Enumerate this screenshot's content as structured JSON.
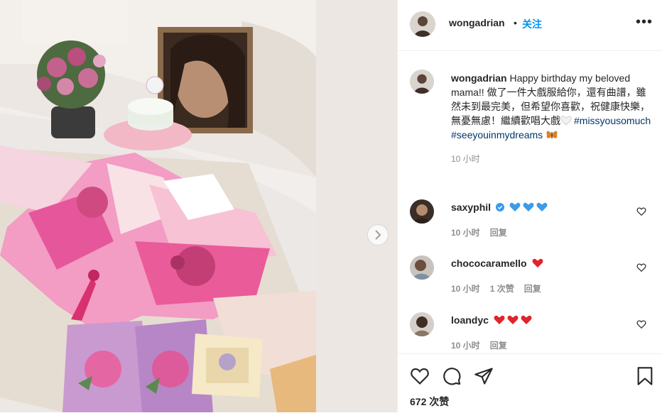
{
  "post": {
    "username": "wongadrian",
    "follow_label": "关注",
    "more_label": "•••"
  },
  "caption": {
    "username": "wongadrian",
    "text": "Happy birthday my beloved mama!! 做了一件大戲服給你，還有曲譜，雖然未到最完美，但希望你喜歡，祝健康快樂，無憂無慮！繼續歡唱大戲",
    "tags": [
      "#missyousomuch",
      "#seeyouinmydreams"
    ],
    "time": "10 小时"
  },
  "comments": [
    {
      "username": "saxyphil",
      "verified": true,
      "emoji": [
        "blue-heart",
        "blue-heart",
        "blue-heart"
      ],
      "time": "10 小时",
      "likes": "",
      "reply": "回复"
    },
    {
      "username": "chococaramello",
      "verified": false,
      "emoji": [
        "red-heart"
      ],
      "time": "10 小时",
      "likes": "1 次赞",
      "reply": "回复"
    },
    {
      "username": "loandyc",
      "verified": false,
      "emoji": [
        "red-heart",
        "red-heart",
        "red-heart"
      ],
      "time": "10 小时",
      "likes": "",
      "reply": "回复"
    }
  ],
  "likes_count": "672 次赞",
  "colors": {
    "link": "#0095f6",
    "hashtag": "#00376b",
    "muted": "#8e8e8e",
    "blue_heart": "#3c9bea",
    "red_heart": "#e0242b"
  }
}
